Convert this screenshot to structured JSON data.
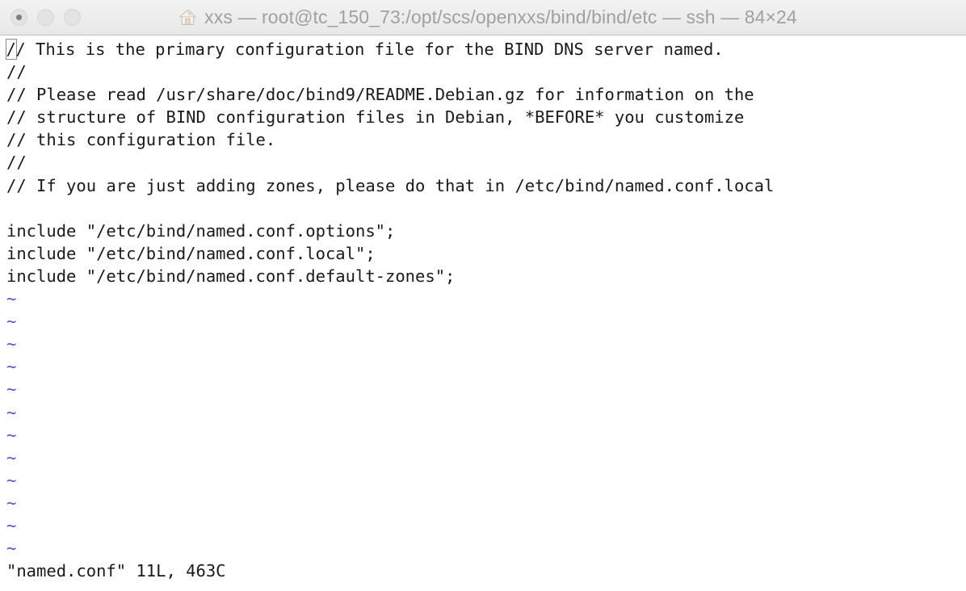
{
  "window": {
    "title": "xxs — root@tc_150_73:/opt/scs/openxxs/bind/bind/etc — ssh — 84×24",
    "app_name": "xxs",
    "user_host_path": "root@tc_150_73:/opt/scs/openxxs/bind/bind/etc",
    "connection": "ssh",
    "dimensions": "84×24",
    "icon": "home-icon",
    "title_color": "#a0a0a0",
    "titlebar_bg": "#ececec"
  },
  "traffic_lights": [
    {
      "name": "close-button",
      "label": "close",
      "active": false,
      "has_dot": true
    },
    {
      "name": "minimize-button",
      "label": "minimize",
      "active": false,
      "has_dot": false
    },
    {
      "name": "zoom-button",
      "label": "zoom",
      "active": false,
      "has_dot": false
    }
  ],
  "editor": {
    "program": "vim",
    "cursor": {
      "row": 1,
      "col": 1,
      "char": "/",
      "style": "hollow-block"
    },
    "text_color": "#1a1a1a",
    "tilde_color": "#4f4fcf",
    "background": "#ffffff",
    "file_lines": [
      "// This is the primary configuration file for the BIND DNS server named.",
      "//",
      "// Please read /usr/share/doc/bind9/README.Debian.gz for information on the",
      "// structure of BIND configuration files in Debian, *BEFORE* you customize",
      "// this configuration file.",
      "//",
      "// If you are just adding zones, please do that in /etc/bind/named.conf.local",
      "",
      "include \"/etc/bind/named.conf.options\";",
      "include \"/etc/bind/named.conf.local\";",
      "include \"/etc/bind/named.conf.default-zones\";"
    ],
    "empty_line_marker": "~",
    "empty_line_count": 12,
    "status_line": "\"named.conf\" 11L, 463C",
    "file_name": "named.conf",
    "line_count": "11L",
    "char_count": "463C"
  }
}
